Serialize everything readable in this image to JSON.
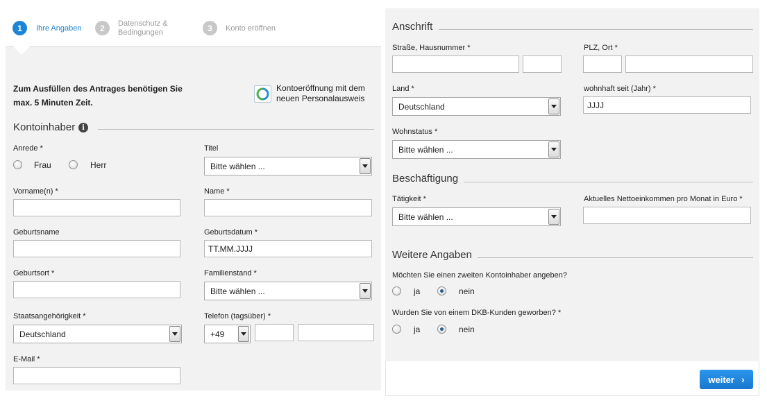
{
  "steps": [
    {
      "number": "1",
      "label": "Ihre Angaben"
    },
    {
      "number": "2",
      "label_line1": "Datenschutz &",
      "label_line2": "Bedingungen"
    },
    {
      "number": "3",
      "label": "Konto eröffnen"
    }
  ],
  "intro": {
    "line1": "Zum Ausfüllen des Antrages benötigen Sie",
    "line2": "max. 5 Minuten Zeit.",
    "id_line1": "Kontoeröffnung mit dem",
    "id_line2": "neuen Personalausweis"
  },
  "kontoinhaber": {
    "title": "Kontoinhaber",
    "info_icon": "i",
    "anrede_label": "Anrede *",
    "frau": "Frau",
    "herr": "Herr",
    "titel_label": "Titel",
    "titel_value": "Bitte wählen ...",
    "vorname_label": "Vorname(n) *",
    "vorname_value": "",
    "name_label": "Name *",
    "name_value": "",
    "geburtsname_label": "Geburtsname",
    "geburtsname_value": "",
    "geburtsdatum_label": "Geburtsdatum *",
    "geburtsdatum_value": "TT.MM.JJJJ",
    "geburtsort_label": "Geburtsort *",
    "geburtsort_value": "",
    "familienstand_label": "Familienstand *",
    "familienstand_value": "Bitte wählen ...",
    "staat_label": "Staatsangehörigkeit *",
    "staat_value": "Deutschland",
    "telefon_label": "Telefon (tagsüber) *",
    "telefon_prefix": "+49",
    "email_label": "E-Mail *",
    "email_value": ""
  },
  "anschrift": {
    "title": "Anschrift",
    "strasse_label": "Straße, Hausnummer *",
    "plz_label": "PLZ, Ort *",
    "land_label": "Land *",
    "land_value": "Deutschland",
    "wohnhaft_label": "wohnhaft seit (Jahr) *",
    "wohnhaft_value": "JJJJ",
    "wohnstatus_label": "Wohnstatus *",
    "wohnstatus_value": "Bitte wählen ..."
  },
  "beschaeftigung": {
    "title": "Beschäftigung",
    "taetigkeit_label": "Tätigkeit *",
    "taetigkeit_value": "Bitte wählen ...",
    "einkommen_label": "Aktuelles Nettoeinkommen pro Monat in Euro *"
  },
  "weitere": {
    "title": "Weitere Angaben",
    "q1": "Möchten Sie einen zweiten Kontoinhaber angeben?",
    "q2": "Wurden Sie von einem DKB-Kunden geworben? *",
    "ja": "ja",
    "nein": "nein"
  },
  "footer": {
    "weiter_label": "weiter",
    "weiter_arrow": "›"
  },
  "colors": {
    "accent": "#1b84d6",
    "step_inactive": "#c8c8c8",
    "button": "#1a83e0"
  }
}
